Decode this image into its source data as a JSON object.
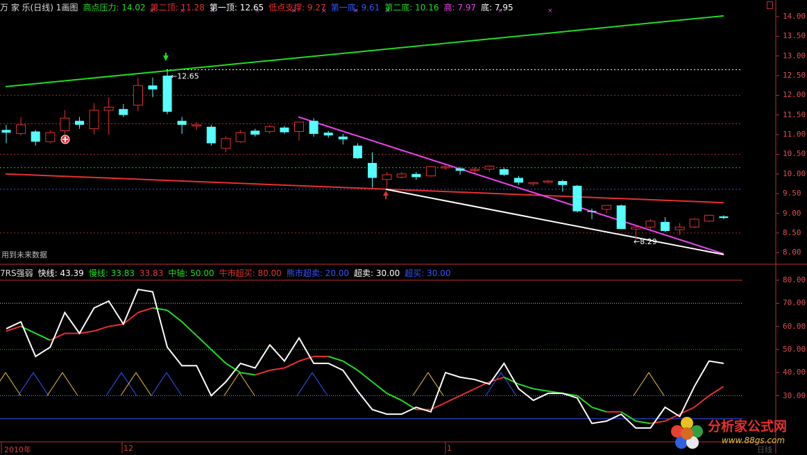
{
  "top_header": {
    "stock": "万 家 乐(日线) 1画图",
    "items": [
      {
        "label": "高点压力:",
        "value": "14.02",
        "color": "#22dd22"
      },
      {
        "label": "第二顶:",
        "value": "11.28",
        "color": "#e83030"
      },
      {
        "label": "第一顶:",
        "value": "12.65",
        "color": "#ffffff"
      },
      {
        "label": "低点支撑:",
        "value": "9.27",
        "color": "#e83030"
      },
      {
        "label": "第一底:",
        "value": "9.61",
        "color": "#3355ff"
      },
      {
        "label": "第二底:",
        "value": "10.16",
        "color": "#22dd22"
      },
      {
        "label": "高:",
        "value": "7.97",
        "color": "#ee44ee"
      },
      {
        "label": "底:",
        "value": "7.95",
        "color": "#ffffff"
      }
    ]
  },
  "rsi_header": {
    "title": "7RS强弱",
    "items": [
      {
        "label": "快线:",
        "value": "43.39",
        "color": "#ffffff"
      },
      {
        "label": "慢线:",
        "value": "33.83",
        "color": "#22dd22"
      },
      {
        "label": "",
        "value": "33.83",
        "color": "#e83030"
      },
      {
        "label": "中轴:",
        "value": "50.00",
        "color": "#22dd22"
      },
      {
        "label": "牛市超买:",
        "value": "80.00",
        "color": "#e83030"
      },
      {
        "label": "熊市超卖:",
        "value": "20.00",
        "color": "#3355ff"
      },
      {
        "label": "超卖:",
        "value": "30.00",
        "color": "#ffffff"
      },
      {
        "label": "超买:",
        "value": "30.00",
        "color": "#3355ff"
      }
    ]
  },
  "price_axis_labels": [
    "14.00",
    "13.50",
    "13.00",
    "12.50",
    "12.00",
    "11.50",
    "11.00",
    "10.50",
    "10.00",
    "9.50",
    "9.00",
    "8.50",
    "8.00"
  ],
  "rsi_axis_labels": [
    "80.00",
    "70.00",
    "60.00",
    "50.00",
    "40.00",
    "30.00"
  ],
  "annotations": {
    "top_peak": "12.65",
    "bottom_low": "8.29",
    "future_data": "用到未来数据"
  },
  "time_axis": {
    "year": "2010年",
    "m12": "12",
    "m1": "1",
    "date_btn": "日线"
  },
  "logo": {
    "text": "分析家公式网",
    "url": "www.88gs.com"
  },
  "colors": {
    "bull": "#e83030",
    "bear": "#55ffff",
    "support": "#e83030",
    "resistance": "#22dd22",
    "down_trend": "#ee44ee"
  },
  "chart_data": {
    "type": "candlestick",
    "ylim": [
      7.85,
      14.2
    ],
    "candles": [
      {
        "o": 11.12,
        "h": 11.25,
        "l": 10.78,
        "c": 11.05
      },
      {
        "o": 11.03,
        "h": 11.45,
        "l": 10.98,
        "c": 11.25
      },
      {
        "o": 11.08,
        "h": 11.12,
        "l": 10.72,
        "c": 10.82
      },
      {
        "o": 10.82,
        "h": 11.12,
        "l": 10.78,
        "c": 11.05
      },
      {
        "o": 11.1,
        "h": 11.62,
        "l": 11.0,
        "c": 11.42
      },
      {
        "o": 11.35,
        "h": 11.45,
        "l": 11.15,
        "c": 11.25
      },
      {
        "o": 11.15,
        "h": 11.8,
        "l": 11.0,
        "c": 11.62
      },
      {
        "o": 11.62,
        "h": 11.95,
        "l": 11.0,
        "c": 11.7
      },
      {
        "o": 11.65,
        "h": 11.78,
        "l": 11.45,
        "c": 11.5
      },
      {
        "o": 11.75,
        "h": 12.45,
        "l": 11.6,
        "c": 12.25
      },
      {
        "o": 12.25,
        "h": 12.45,
        "l": 11.95,
        "c": 12.15
      },
      {
        "o": 12.5,
        "h": 12.62,
        "l": 11.52,
        "c": 11.58
      },
      {
        "o": 11.35,
        "h": 11.45,
        "l": 11.02,
        "c": 11.25
      },
      {
        "o": 11.22,
        "h": 11.32,
        "l": 11.12,
        "c": 11.25
      },
      {
        "o": 11.2,
        "h": 11.25,
        "l": 10.72,
        "c": 10.78
      },
      {
        "o": 10.65,
        "h": 10.95,
        "l": 10.55,
        "c": 10.9
      },
      {
        "o": 10.82,
        "h": 11.12,
        "l": 10.8,
        "c": 11.05
      },
      {
        "o": 11.1,
        "h": 11.15,
        "l": 10.95,
        "c": 11.0
      },
      {
        "o": 11.08,
        "h": 11.25,
        "l": 11.02,
        "c": 11.2
      },
      {
        "o": 11.18,
        "h": 11.22,
        "l": 11.02,
        "c": 11.06
      },
      {
        "o": 11.08,
        "h": 11.32,
        "l": 10.85,
        "c": 11.32
      },
      {
        "o": 11.35,
        "h": 11.42,
        "l": 10.95,
        "c": 11.02
      },
      {
        "o": 11.05,
        "h": 11.1,
        "l": 10.92,
        "c": 10.98
      },
      {
        "o": 10.95,
        "h": 11.02,
        "l": 10.75,
        "c": 10.88
      },
      {
        "o": 10.72,
        "h": 10.78,
        "l": 10.38,
        "c": 10.4
      },
      {
        "o": 10.28,
        "h": 10.55,
        "l": 9.65,
        "c": 9.9
      },
      {
        "o": 9.86,
        "h": 10.05,
        "l": 9.66,
        "c": 9.98
      },
      {
        "o": 9.92,
        "h": 10.05,
        "l": 9.88,
        "c": 10.0
      },
      {
        "o": 10.0,
        "h": 10.05,
        "l": 9.85,
        "c": 9.92
      },
      {
        "o": 9.95,
        "h": 10.15,
        "l": 9.93,
        "c": 10.18
      },
      {
        "o": 10.16,
        "h": 10.22,
        "l": 10.1,
        "c": 10.18
      },
      {
        "o": 10.14,
        "h": 10.18,
        "l": 9.98,
        "c": 10.08
      },
      {
        "o": 10.1,
        "h": 10.18,
        "l": 10.02,
        "c": 10.12
      },
      {
        "o": 10.12,
        "h": 10.22,
        "l": 10.05,
        "c": 10.2
      },
      {
        "o": 10.12,
        "h": 10.16,
        "l": 9.95,
        "c": 9.98
      },
      {
        "o": 9.9,
        "h": 9.95,
        "l": 9.72,
        "c": 9.78
      },
      {
        "o": 9.75,
        "h": 9.8,
        "l": 9.7,
        "c": 9.78
      },
      {
        "o": 9.8,
        "h": 9.85,
        "l": 9.76,
        "c": 9.82
      },
      {
        "o": 9.82,
        "h": 9.85,
        "l": 9.55,
        "c": 9.72
      },
      {
        "o": 9.7,
        "h": 9.72,
        "l": 9.02,
        "c": 9.05
      },
      {
        "o": 9.06,
        "h": 9.12,
        "l": 8.85,
        "c": 9.04
      },
      {
        "o": 9.1,
        "h": 9.2,
        "l": 9.0,
        "c": 9.2
      },
      {
        "o": 9.2,
        "h": 9.22,
        "l": 8.6,
        "c": 8.6
      },
      {
        "o": 8.6,
        "h": 8.7,
        "l": 8.29,
        "c": 8.65
      },
      {
        "o": 8.65,
        "h": 8.85,
        "l": 8.6,
        "c": 8.8
      },
      {
        "o": 8.78,
        "h": 8.9,
        "l": 8.52,
        "c": 8.55
      },
      {
        "o": 8.58,
        "h": 8.75,
        "l": 8.45,
        "c": 8.65
      },
      {
        "o": 8.65,
        "h": 8.88,
        "l": 8.62,
        "c": 8.85
      },
      {
        "o": 8.8,
        "h": 8.96,
        "l": 8.78,
        "c": 8.95
      },
      {
        "o": 8.92,
        "h": 8.95,
        "l": 8.85,
        "c": 8.88
      }
    ],
    "rsi": {
      "fast": [
        59,
        62,
        47,
        51,
        66,
        57,
        68,
        71,
        61,
        76,
        75,
        51,
        43,
        43,
        30,
        36,
        44,
        42,
        52,
        45,
        55,
        44,
        44,
        41,
        32,
        24,
        22,
        22,
        25,
        23,
        40,
        38,
        37,
        35,
        44,
        33,
        28,
        31,
        31,
        29,
        18,
        19,
        22,
        16,
        16,
        25,
        21,
        34,
        45,
        44
      ],
      "slow": [
        58,
        60,
        57,
        54,
        57,
        57,
        58,
        60,
        61,
        66,
        68,
        67,
        62,
        56,
        50,
        44,
        40,
        39,
        41,
        42,
        45,
        47,
        47,
        45,
        41,
        36,
        31,
        28,
        24,
        24,
        27,
        30,
        33,
        36,
        38,
        35,
        33,
        32,
        31,
        30,
        25,
        23,
        23,
        19,
        18,
        19,
        22,
        25,
        30,
        34
      ]
    }
  }
}
